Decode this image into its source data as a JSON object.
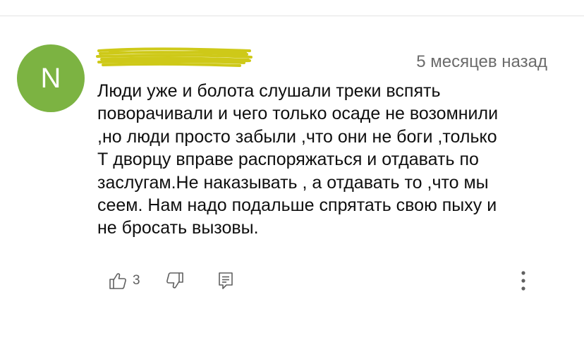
{
  "comment": {
    "avatar_letter": "N",
    "avatar_color": "#7cb342",
    "author_scribble_color": "#c9c400",
    "timestamp": "5 месяцев назад",
    "text_lines": [
      "Люди уже и болота слушали треки вспять",
      "поворачивали и чего только осаде не возомнили",
      ",но люди просто забыли ,что они не боги ,только",
      "Т дворцу вправе распоряжаться и отдавать по",
      "заслугам.Не наказывать , а отдавать то ,что мы",
      "сеем. Нам надо подальше спрятать свою пыху и",
      "не бросать вызовы."
    ]
  },
  "actions": {
    "like_icon": "thumb-up-icon",
    "like_count": "3",
    "dislike_icon": "thumb-down-icon",
    "reply_icon": "reply-icon",
    "more_icon": "more-vertical-icon"
  }
}
